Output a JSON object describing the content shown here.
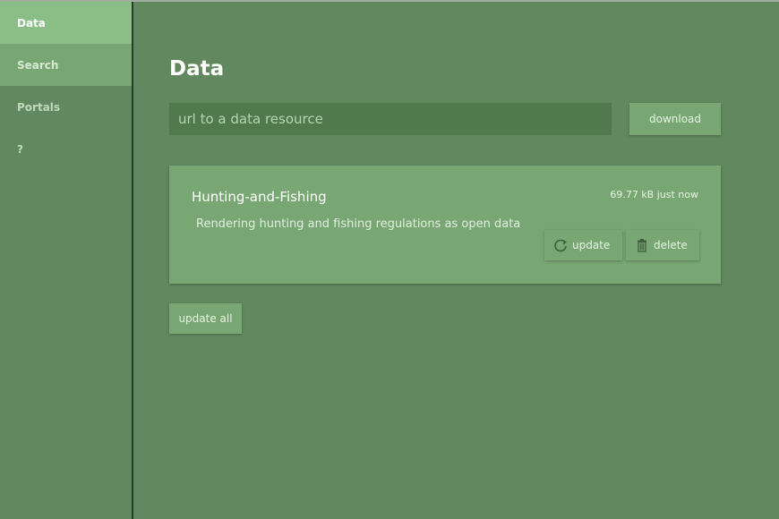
{
  "sidebar": {
    "items": [
      {
        "label": "Data"
      },
      {
        "label": "Search"
      },
      {
        "label": "Portals"
      },
      {
        "label": "?"
      }
    ]
  },
  "main": {
    "title": "Data",
    "url_input": {
      "placeholder": "url to a data resource",
      "value": ""
    },
    "download_label": "download",
    "dataset": {
      "name": "Hunting-and-Fishing",
      "meta": "69.77 kB just now",
      "description": "Rendering hunting and fishing regulations as open data",
      "update_label": "update",
      "delete_label": "delete"
    },
    "update_all_label": "update all"
  },
  "colors": {
    "background": "#62885f",
    "sidebar_active": "#8bbd86",
    "button": "#78a774",
    "input": "#507a4d"
  },
  "icons": {
    "update": "refresh-icon",
    "delete": "trash-icon"
  }
}
